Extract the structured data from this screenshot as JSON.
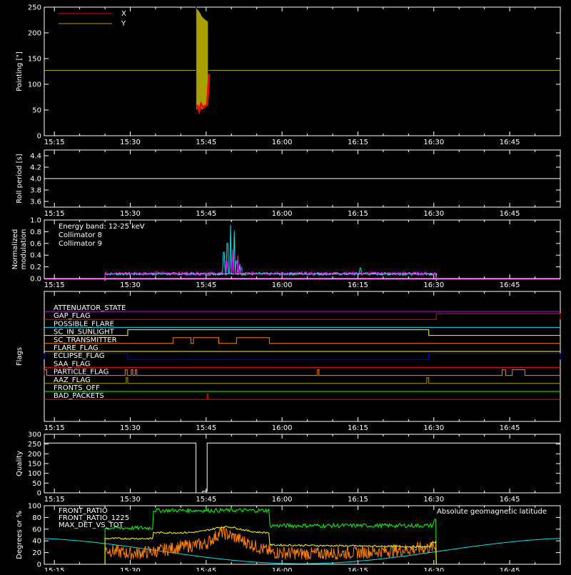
{
  "time_ticks": [
    "15:15",
    "15:30",
    "15:45",
    "16:00",
    "16:15",
    "16:30",
    "16:45"
  ],
  "time_tick_values": [
    915,
    930,
    945,
    960,
    975,
    990,
    1005
  ],
  "x_range": [
    913,
    1015
  ],
  "colors": {
    "x": "#ff0000",
    "y": "#a8a000",
    "white": "#ffffff",
    "cyan": "#00e5e5",
    "magenta": "#ff00ff",
    "green": "#00ff00",
    "yellow": "#ffff00",
    "orange": "#ff8000",
    "blue": "#0000ff",
    "purple": "#c000ff"
  },
  "chart_data": [
    {
      "type": "line",
      "ylabel": "Pointing [\"]",
      "ylim": [
        0,
        250
      ],
      "yticks": [
        0,
        50,
        100,
        150,
        200,
        250
      ],
      "legend_placement": "top-left",
      "series": [
        {
          "name": "X",
          "color": "#ff0000",
          "x": [
            943.2,
            943.6,
            944.0,
            944.4,
            944.8,
            945.2,
            945.6
          ],
          "y": [
            60,
            48,
            62,
            55,
            58,
            60,
            120
          ]
        },
        {
          "name": "Y",
          "color": "#a8a000",
          "x": [
            943.0,
            943.4,
            943.8,
            944.2,
            944.6,
            945.0,
            945.4
          ],
          "y": [
            250,
            245,
            240,
            232,
            228,
            225,
            222
          ],
          "y_low": [
            50,
            52,
            55,
            50,
            54,
            58,
            60
          ]
        }
      ],
      "reference_line": 127
    },
    {
      "type": "line",
      "ylabel": "Roll period [s]",
      "ylim": [
        3.5,
        4.5
      ],
      "yticks": [
        3.6,
        3.8,
        4.0,
        4.2,
        4.4
      ],
      "series": [
        {
          "color": "#ffffff",
          "x": [
            913,
            1015
          ],
          "y": [
            4.0,
            4.0
          ]
        }
      ]
    },
    {
      "type": "line",
      "ylabel": "Normalized modulation",
      "ylim": [
        0,
        1.0
      ],
      "yticks": [
        0.0,
        0.2,
        0.4,
        0.6,
        0.8,
        1.0
      ],
      "annotation": "Energy band: 12-25 keV",
      "series": [
        {
          "name": "Collimator 8",
          "color": "#00e5e5",
          "baseline": 0.08,
          "peaks": [
            [
              948.5,
              0.45
            ],
            [
              949.2,
              0.6
            ],
            [
              949.8,
              0.92
            ],
            [
              950.6,
              0.82
            ],
            [
              951.0,
              0.3
            ],
            [
              951.6,
              0.25
            ],
            [
              975.5,
              0.18
            ]
          ]
        },
        {
          "name": "Collimator 9",
          "color": "#ff00ff",
          "baseline": 0.09,
          "peaks": [
            [
              949.0,
              0.3
            ],
            [
              950.2,
              0.5
            ],
            [
              951.3,
              0.4
            ],
            [
              952.0,
              0.2
            ]
          ]
        }
      ],
      "x_span": [
        925,
        990.5
      ]
    },
    {
      "type": "table",
      "ylabel": "Flags",
      "flags": [
        {
          "name": "ATTENUATOR_STATE",
          "color": "#c000ff",
          "segments": []
        },
        {
          "name": "GAP_FLAG",
          "color": "#ff0000",
          "segments": [
            [
              990.5,
              1015
            ]
          ]
        },
        {
          "name": "POSSIBLE_FLARE",
          "color": "#00e5e5",
          "segments": []
        },
        {
          "name": "SC_IN_SUNLIGHT",
          "color": "#ffff00",
          "segments": [
            [
              929.5,
              989
            ]
          ]
        },
        {
          "name": "SC_TRANSMITTER",
          "color": "#ff8000",
          "segments": [
            [
              938.5,
              942
            ],
            [
              942.5,
              947.5
            ],
            [
              951,
              957.5
            ]
          ]
        },
        {
          "name": "FLARE_FLAG",
          "color": "#ffff00",
          "segments": []
        },
        {
          "name": "ECLIPSE_FLAG",
          "color": "#0000ff",
          "segments": [
            [
              913,
              929.5
            ],
            [
              989,
              1015
            ]
          ]
        },
        {
          "name": "SAA_FLAG",
          "color": "#ff0000",
          "segments": []
        },
        {
          "name": "PARTICLE_FLAG",
          "color": "#ff8000",
          "segments": [
            [
              913,
              913.5
            ],
            [
              929,
              929.4
            ],
            [
              930.2,
              930.5
            ],
            [
              931.0,
              931.3
            ],
            [
              967.0,
              967.3
            ],
            [
              1003.5,
              1004.2
            ],
            [
              1005.5,
              1008
            ]
          ]
        },
        {
          "name": "AAZ_FLAG",
          "color": "#a8a000",
          "segments": [
            [
              929.2,
              929.5
            ],
            [
              988.6,
              989
            ]
          ]
        },
        {
          "name": "FRONTS_OFF",
          "color": "#00ff00",
          "segments": []
        },
        {
          "name": "BAD_PACKETS",
          "color": "#ff0000",
          "segments": [
            [
              945.2,
              945.4
            ]
          ]
        }
      ]
    },
    {
      "type": "line",
      "ylabel": "Quality",
      "ylim": [
        0,
        300
      ],
      "yticks": [
        0,
        50,
        100,
        150,
        200,
        250,
        300
      ],
      "series": [
        {
          "color": "#ffffff",
          "x": [
            913,
            943,
            943,
            944.3,
            944.3,
            945.2,
            945.2,
            1015
          ],
          "y": [
            255,
            255,
            0,
            0,
            8,
            8,
            255,
            255
          ]
        }
      ]
    },
    {
      "type": "line",
      "ylabel": "Degrees or %",
      "ylim": [
        0,
        100
      ],
      "yticks": [
        0,
        20,
        40,
        60,
        80,
        100
      ],
      "series": [
        {
          "name": "FRONT_RATIO",
          "color": "#ffff00",
          "x": [
            925,
            934.5,
            934.5,
            947.5,
            950,
            953,
            957.5,
            957.5,
            990.5,
            990.5
          ],
          "y": [
            45,
            45,
            52,
            60,
            65,
            60,
            52,
            35,
            30,
            37
          ]
        },
        {
          "name": "FRONT_RATIO_1225",
          "color": "#00ff00",
          "x": [
            925,
            934.5,
            934.5,
            957.5,
            957.5,
            990.5,
            990.5,
            990.5
          ],
          "y": [
            60,
            60,
            93,
            92,
            68,
            62,
            75,
            0
          ]
        },
        {
          "name": "MAX_DET_VS_TOT",
          "color": "#ff8000",
          "x": [
            925,
            930,
            935,
            940,
            945,
            948,
            951,
            955,
            958,
            965,
            975,
            985,
            990.5
          ],
          "y": [
            25,
            18,
            22,
            30,
            35,
            55,
            45,
            30,
            20,
            18,
            20,
            25,
            30
          ]
        },
        {
          "name": "Absolute geomagnetic latitude",
          "color": "#00e5e5",
          "model": "sine"
        }
      ]
    }
  ]
}
